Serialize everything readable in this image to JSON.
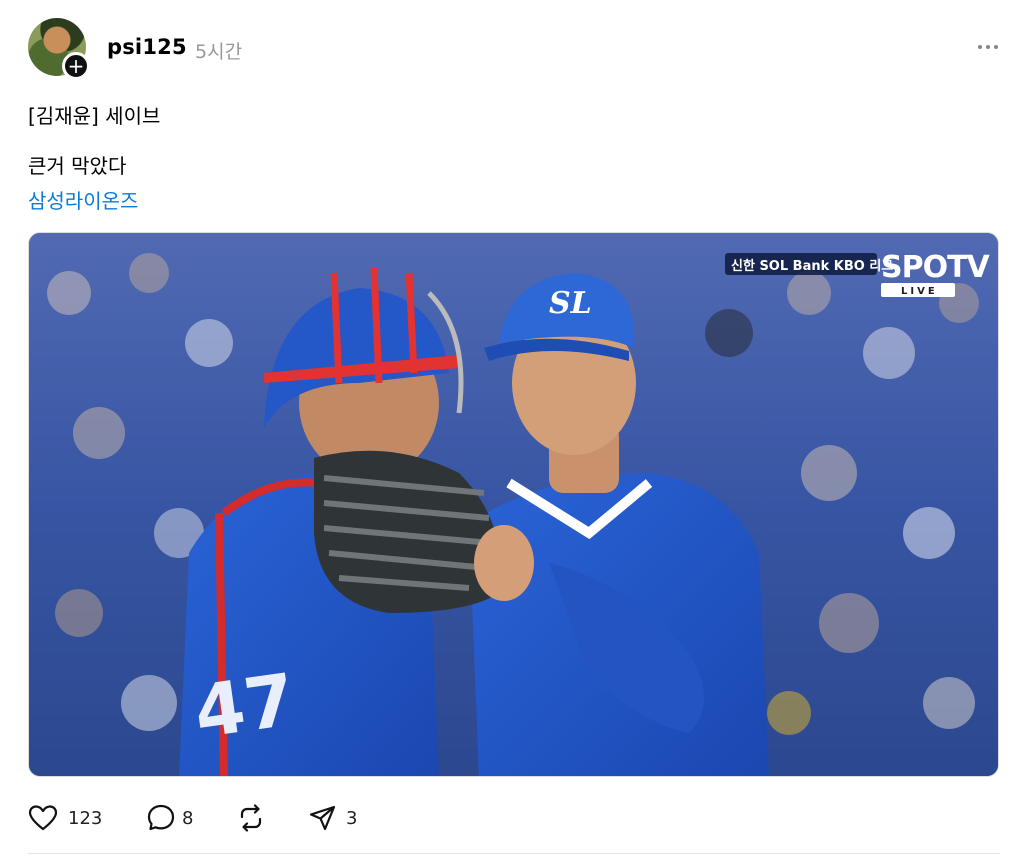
{
  "post": {
    "username": "psi125",
    "time": "5시간",
    "text_line1": "[김재윤] 세이브",
    "text_line2": "큰거 막았다",
    "tag": "삼성라이온즈"
  },
  "media": {
    "overlay_sponsor": "신한 SOL Bank KBO 리그",
    "overlay_channel": "SPOTV",
    "overlay_live": "LIVE",
    "cap_logo": "SL",
    "catcher_number": "47"
  },
  "actions": {
    "likes": "123",
    "replies": "8",
    "shares": "3"
  },
  "colors": {
    "link": "#0a7bd9",
    "jersey_blue": "#1f55c7"
  }
}
